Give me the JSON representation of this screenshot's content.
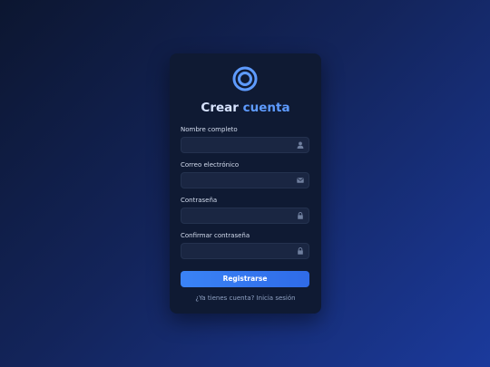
{
  "colors": {
    "accent": "#5e9bff",
    "button": "#3a83f6",
    "card_bg": "#0f1a33",
    "field_bg": "#1a2642"
  },
  "logo": {
    "icon": "ring-logo-icon"
  },
  "title": {
    "part1": "Crear",
    "part2": "cuenta"
  },
  "fields": [
    {
      "label": "Nombre completo",
      "value": "",
      "icon": "user-icon",
      "type": "text"
    },
    {
      "label": "Correo electrónico",
      "value": "",
      "icon": "envelope-icon",
      "type": "email"
    },
    {
      "label": "Contraseña",
      "value": "",
      "icon": "lock-icon",
      "type": "password"
    },
    {
      "label": "Confirmar contraseña",
      "value": "",
      "icon": "lock-icon",
      "type": "password"
    }
  ],
  "submit": {
    "label": "Registrarse"
  },
  "footer": {
    "question": "¿Ya tienes cuenta?",
    "link": "Inicia sesión"
  }
}
